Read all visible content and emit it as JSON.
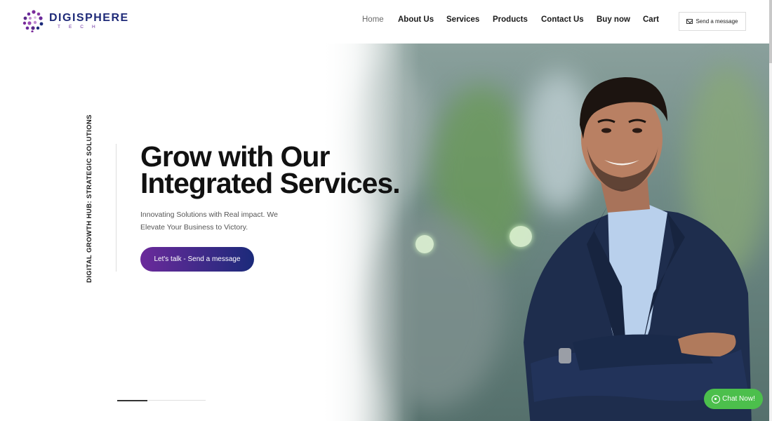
{
  "brand": {
    "name": "DIGISPHERE",
    "sub": "TECH",
    "accent": "#6b2a9b",
    "primary": "#1b2a7a"
  },
  "nav": {
    "items": [
      {
        "label": "Home",
        "active": true
      },
      {
        "label": "About Us"
      },
      {
        "label": "Services"
      },
      {
        "label": "Products"
      },
      {
        "label": "Contact Us"
      },
      {
        "label": "Buy now"
      },
      {
        "label": "Cart"
      }
    ],
    "send_button": "Send a message",
    "send_icon": "envelope-icon"
  },
  "hero": {
    "tagline": "DIGITAL GROWTH HUB: STRATEGIC SOLUTIONS",
    "headline_1": "Grow with Our",
    "headline_2": "Integrated Services.",
    "subtext": "Innovating Solutions with Real impact. We Elevate Your Business to Victory.",
    "cta": "Let's talk - Send a message"
  },
  "chat": {
    "label": "Chat Now!",
    "icon": "whatsapp-icon",
    "color": "#4cbf4c"
  }
}
